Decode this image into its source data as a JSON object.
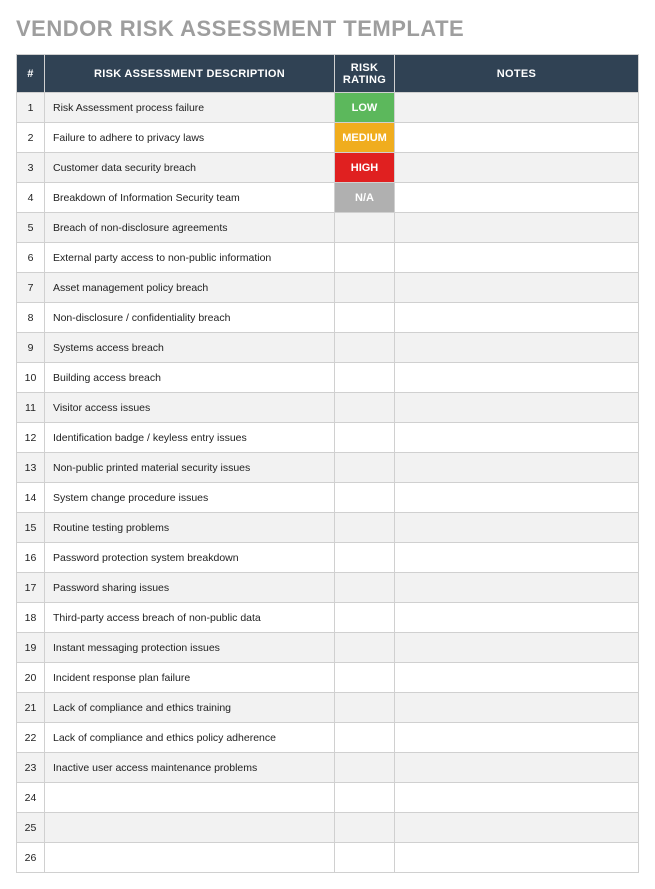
{
  "title": "VENDOR RISK ASSESSMENT TEMPLATE",
  "headers": {
    "num": "#",
    "description": "RISK ASSESSMENT DESCRIPTION",
    "rating": "RISK RATING",
    "notes": "NOTES"
  },
  "ratingColors": {
    "LOW": "rating-low",
    "MEDIUM": "rating-medium",
    "HIGH": "rating-high",
    "N/A": "rating-na"
  },
  "rows": [
    {
      "num": "1",
      "description": "Risk Assessment process failure",
      "rating": "LOW",
      "notes": ""
    },
    {
      "num": "2",
      "description": "Failure to adhere to privacy laws",
      "rating": "MEDIUM",
      "notes": ""
    },
    {
      "num": "3",
      "description": "Customer data security breach",
      "rating": "HIGH",
      "notes": ""
    },
    {
      "num": "4",
      "description": "Breakdown of Information Security team",
      "rating": "N/A",
      "notes": ""
    },
    {
      "num": "5",
      "description": "Breach of non-disclosure agreements",
      "rating": "",
      "notes": ""
    },
    {
      "num": "6",
      "description": "External party access to non-public information",
      "rating": "",
      "notes": ""
    },
    {
      "num": "7",
      "description": "Asset management policy breach",
      "rating": "",
      "notes": ""
    },
    {
      "num": "8",
      "description": "Non-disclosure / confidentiality breach",
      "rating": "",
      "notes": ""
    },
    {
      "num": "9",
      "description": "Systems access breach",
      "rating": "",
      "notes": ""
    },
    {
      "num": "10",
      "description": "Building access breach",
      "rating": "",
      "notes": ""
    },
    {
      "num": "11",
      "description": "Visitor access issues",
      "rating": "",
      "notes": ""
    },
    {
      "num": "12",
      "description": "Identification badge / keyless entry issues",
      "rating": "",
      "notes": ""
    },
    {
      "num": "13",
      "description": "Non-public printed material security issues",
      "rating": "",
      "notes": ""
    },
    {
      "num": "14",
      "description": "System change procedure issues",
      "rating": "",
      "notes": ""
    },
    {
      "num": "15",
      "description": "Routine testing problems",
      "rating": "",
      "notes": ""
    },
    {
      "num": "16",
      "description": "Password protection system breakdown",
      "rating": "",
      "notes": ""
    },
    {
      "num": "17",
      "description": "Password sharing issues",
      "rating": "",
      "notes": ""
    },
    {
      "num": "18",
      "description": "Third-party access breach of non-public data",
      "rating": "",
      "notes": ""
    },
    {
      "num": "19",
      "description": "Instant messaging protection issues",
      "rating": "",
      "notes": ""
    },
    {
      "num": "20",
      "description": "Incident response plan failure",
      "rating": "",
      "notes": ""
    },
    {
      "num": "21",
      "description": "Lack of compliance and ethics training",
      "rating": "",
      "notes": ""
    },
    {
      "num": "22",
      "description": "Lack of compliance and ethics policy adherence",
      "rating": "",
      "notes": ""
    },
    {
      "num": "23",
      "description": "Inactive user access maintenance problems",
      "rating": "",
      "notes": ""
    },
    {
      "num": "24",
      "description": "",
      "rating": "",
      "notes": ""
    },
    {
      "num": "25",
      "description": "",
      "rating": "",
      "notes": ""
    },
    {
      "num": "26",
      "description": "",
      "rating": "",
      "notes": ""
    }
  ]
}
